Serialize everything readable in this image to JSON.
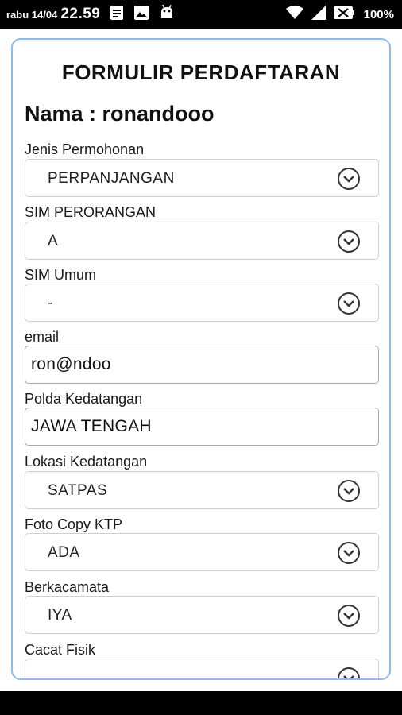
{
  "status_bar": {
    "day": "rabu 14/04",
    "time": "22.59",
    "battery": "100%",
    "left_icons": [
      "notes-icon",
      "image-icon",
      "android-icon"
    ],
    "right_icons": [
      "wifi-icon",
      "signal-icon",
      "battery-icon"
    ]
  },
  "form": {
    "title": "FORMULIR PERDAFTARAN",
    "name_line": "Nama : ronandooo",
    "fields": [
      {
        "label": "Jenis Permohonan",
        "type": "select",
        "value": "PERPANJANGAN"
      },
      {
        "label": "SIM PERORANGAN",
        "type": "select",
        "value": "A"
      },
      {
        "label": "SIM Umum",
        "type": "select",
        "value": "-"
      },
      {
        "label": "email",
        "type": "input",
        "value": "ron@ndoo"
      },
      {
        "label": "Polda Kedatangan",
        "type": "input",
        "value": "JAWA TENGAH"
      },
      {
        "label": "Lokasi Kedatangan",
        "type": "select",
        "value": "SATPAS"
      },
      {
        "label": "Foto Copy KTP",
        "type": "select",
        "value": "ADA"
      },
      {
        "label": "Berkacamata",
        "type": "select",
        "value": "IYA"
      },
      {
        "label": "Cacat Fisik",
        "type": "select",
        "value": ""
      }
    ]
  },
  "colors": {
    "status_bar_bg": "#000000",
    "card_border": "#8bbcec",
    "select_border": "#cfcfcf",
    "input_border": "#a9a9a9"
  }
}
